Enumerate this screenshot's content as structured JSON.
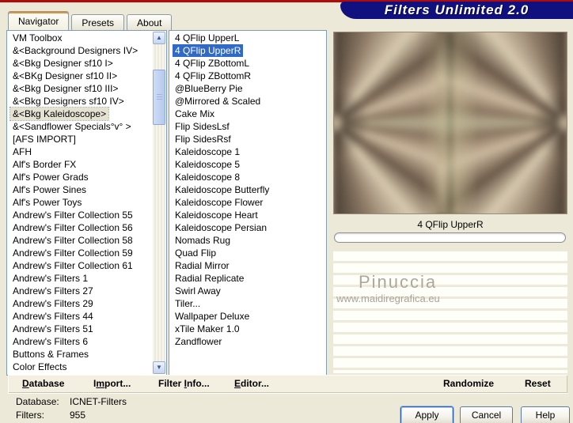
{
  "window": {
    "title": "Filters Unlimited 2.0"
  },
  "tabs": [
    {
      "label": "Navigator"
    },
    {
      "label": "Presets"
    },
    {
      "label": "About"
    }
  ],
  "category_list": {
    "selected_index": 6,
    "items": [
      "VM Toolbox",
      "&<Background Designers IV>",
      "&<Bkg Designer sf10 I>",
      "&<BKg Designer sf10 II>",
      "&<Bkg Designer sf10 III>",
      "&<Bkg Designers sf10 IV>",
      "&<Bkg Kaleidoscope>",
      "&<Sandflower Specials°v° >",
      "[AFS IMPORT]",
      "AFH",
      "Alf's Border FX",
      "Alf's Power Grads",
      "Alf's Power Sines",
      "Alf's Power Toys",
      "Andrew's Filter Collection 55",
      "Andrew's Filter Collection 56",
      "Andrew's Filter Collection 58",
      "Andrew's Filter Collection 59",
      "Andrew's Filter Collection 61",
      "Andrew's Filters 1",
      "Andrew's Filters 27",
      "Andrew's Filters 29",
      "Andrew's Filters 44",
      "Andrew's Filters 51",
      "Andrew's Filters 6",
      "Buttons & Frames",
      "Color Effects"
    ]
  },
  "filter_list": {
    "selected_index": 1,
    "items": [
      "4 QFlip UpperL",
      "4 QFlip UpperR",
      "4 QFlip ZBottomL",
      "4 QFlip ZBottomR",
      "@BlueBerry Pie",
      "@Mirrored & Scaled",
      "Cake Mix",
      "Flip SidesLsf",
      "Flip SidesRsf",
      "Kaleidoscope 1",
      "Kaleidoscope 5",
      "Kaleidoscope 8",
      "Kaleidoscope Butterfly",
      "Kaleidoscope Flower",
      "Kaleidoscope Heart",
      "Kaleidoscope Persian",
      "Nomads Rug",
      "Quad Flip",
      "Radial Mirror",
      "Radial Replicate",
      "Swirl Away",
      "Tiler...",
      "Wallpaper Deluxe",
      "xTile Maker 1.0",
      "Zandflower"
    ]
  },
  "preview": {
    "caption": "4 QFlip UpperR",
    "watermark_line1": "Pinuccia",
    "watermark_line2": "www.maidiregrafica.eu"
  },
  "toolbar": {
    "items": [
      {
        "pre": "",
        "key": "D",
        "post": "atabase"
      },
      {
        "pre": "I",
        "key": "m",
        "post": "port..."
      },
      {
        "pre": "Filter ",
        "key": "I",
        "post": "nfo..."
      },
      {
        "pre": "",
        "key": "E",
        "post": "ditor..."
      },
      {
        "pre": "",
        "key": "",
        "post": "Randomize"
      },
      {
        "pre": "",
        "key": "",
        "post": "Reset"
      }
    ]
  },
  "status": {
    "database_label": "Database:",
    "database_value": "ICNET-Filters",
    "filters_label": "Filters:",
    "filters_value": "955"
  },
  "action_buttons": {
    "apply": "Apply",
    "cancel": "Cancel",
    "help": "Help"
  },
  "colors": {
    "banner": "#10117e",
    "banner_stripe": "#b00b0b",
    "selection_blue": "#316ac5",
    "selection_soft": "#e6e2d2",
    "dialog_bg": "#ece9d8"
  }
}
